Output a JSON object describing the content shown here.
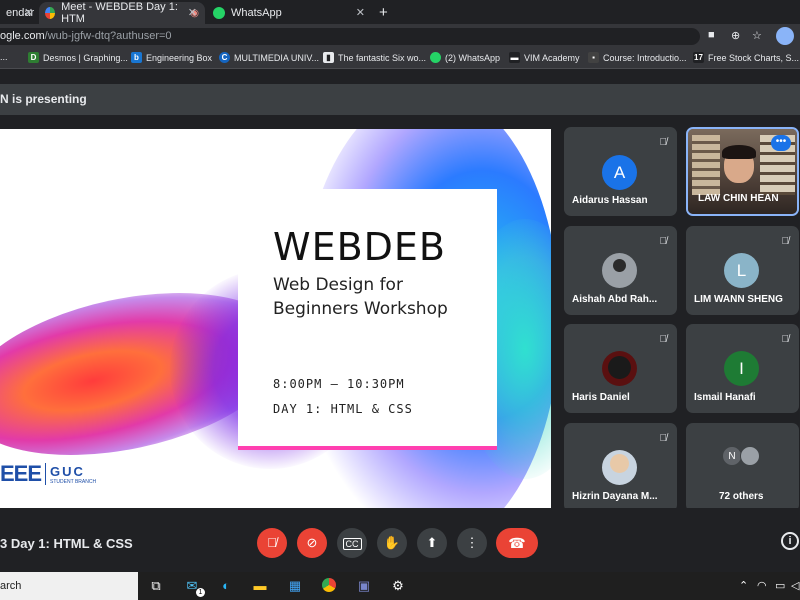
{
  "browser": {
    "tabs": [
      {
        "label": "endar"
      },
      {
        "label": "Meet - WEBDEB Day 1: HTM"
      },
      {
        "label": "WhatsApp"
      }
    ],
    "new_tab": "+",
    "url_host": "ogle.com",
    "url_path": "/wub-jgfw-dtq?authuser=0",
    "bookmarks": [
      {
        "label": "...",
        "icon": "doc-icon"
      },
      {
        "label": "Desmos | Graphing...",
        "icon": "desmos-icon"
      },
      {
        "label": "Engineering Box",
        "icon": "box-icon"
      },
      {
        "label": "MULTIMEDIA UNIV...",
        "icon": "c-icon"
      },
      {
        "label": "The fantastic Six wo...",
        "icon": "page-icon"
      },
      {
        "label": "(2) WhatsApp",
        "icon": "whatsapp-icon"
      },
      {
        "label": "VIM Academy",
        "icon": "vim-icon"
      },
      {
        "label": "Course: Introductio...",
        "icon": "course-icon"
      },
      {
        "label": "Free Stock Charts, S...",
        "icon": "tv-icon"
      }
    ]
  },
  "meet": {
    "presenting_text": "N is presenting",
    "slide": {
      "title": "WEBDEB",
      "subtitle": "Web Design for Beginners Workshop",
      "time": "8:00PM – 10:30PM",
      "day": "DAY 1: HTML & CSS",
      "logo_left": "EEE",
      "logo_right": "GUC",
      "logo_sub": "STUDENT BRANCH"
    },
    "participants": [
      {
        "name": "Aidarus Hassan",
        "initial": "A",
        "color": "#1a73e8"
      },
      {
        "name": "LAW CHIN HEAN",
        "initial": "",
        "color": "#8d6e63"
      },
      {
        "name": "Aishah Abd Rah...",
        "initial": "",
        "color": "#5f6368"
      },
      {
        "name": "LIM WANN SHENG",
        "initial": "L",
        "color": "#8ab4c8"
      },
      {
        "name": "Haris Daniel",
        "initial": "",
        "color": "#7b1f1f"
      },
      {
        "name": "Ismail Hanafi",
        "initial": "I",
        "color": "#1e7b34"
      },
      {
        "name": "Hizrin Dayana M...",
        "initial": "",
        "color": "#a8b8c8"
      },
      {
        "name": "72 others",
        "initial": "N",
        "color": "#5f6368"
      }
    ],
    "meeting_title": "3 Day 1: HTML & CSS"
  },
  "taskbar": {
    "search_text": "arch",
    "mail_badge": "1"
  }
}
